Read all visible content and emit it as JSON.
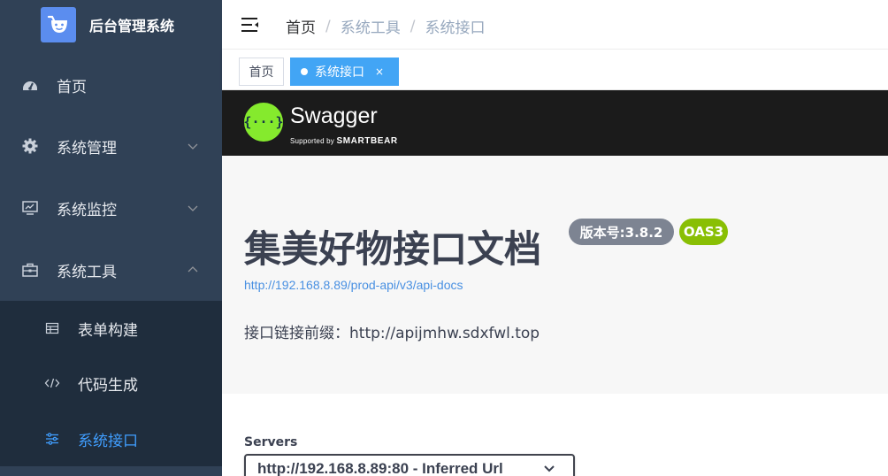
{
  "sidebar": {
    "title": "后台管理系统",
    "menu": [
      {
        "label": "首页",
        "icon": "dashboard-icon"
      },
      {
        "label": "系统管理",
        "icon": "gear-icon"
      },
      {
        "label": "系统监控",
        "icon": "monitor-icon"
      },
      {
        "label": "系统工具",
        "icon": "toolbox-icon"
      }
    ],
    "submenu": [
      {
        "label": "表单构建",
        "icon": "table-icon"
      },
      {
        "label": "代码生成",
        "icon": "code-icon"
      },
      {
        "label": "系统接口",
        "icon": "sliders-icon",
        "active": true
      }
    ],
    "active_color": "#409eff"
  },
  "breadcrumb": {
    "home": "首页",
    "sep": "/",
    "level1": "系统工具",
    "level2": "系统接口"
  },
  "tags": {
    "home": "首页",
    "active": "系统接口",
    "close": "×"
  },
  "swagger": {
    "name": "Swagger",
    "supported_by": "Supported by",
    "smartbear": "SMARTBEAR",
    "logo_glyph": "{···}"
  },
  "info": {
    "title": "集美好物接口文档",
    "version_badge": "版本号:3.8.2",
    "oas_badge": "OAS3",
    "url": "http://192.168.8.89/prod-api/v3/api-docs",
    "description": "接口链接前缀：http://apijmhw.sdxfwl.top"
  },
  "servers": {
    "label": "Servers",
    "selected": "http://192.168.8.89:80 - Inferred Url"
  }
}
